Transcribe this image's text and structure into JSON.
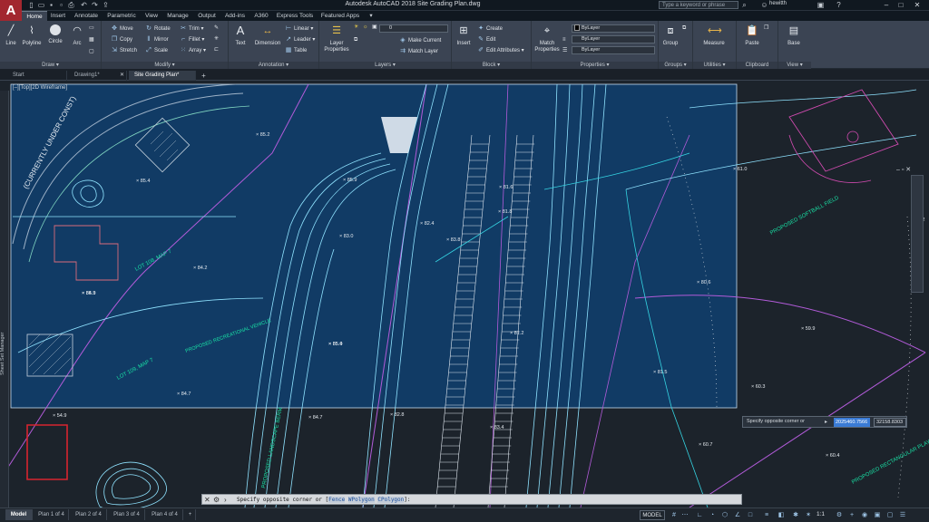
{
  "app": {
    "logo": "A",
    "title": "Autodesk AutoCAD 2018   Site Grading Plan.dwg"
  },
  "qat": [
    "new-file-icon",
    "open-folder-icon",
    "save-icon",
    "save-as-icon",
    "plot-icon",
    "undo-icon",
    "redo-icon",
    "share-icon"
  ],
  "search": {
    "placeholder": "Type a keyword or phrase"
  },
  "user": {
    "name": "hewitth"
  },
  "ribbon_tabs": [
    "Home",
    "Insert",
    "Annotate",
    "Parametric",
    "View",
    "Manage",
    "Output",
    "Add-ins",
    "A360",
    "Express Tools",
    "Featured Apps"
  ],
  "draw": {
    "title": "Draw ▾",
    "line": "Line",
    "polyline": "Polyline",
    "circle": "Circle",
    "arc": "Arc"
  },
  "modify": {
    "title": "Modify ▾",
    "move": "Move",
    "rotate": "Rotate",
    "trim": "Trim ▾",
    "copy": "Copy",
    "mirror": "Mirror",
    "fillet": "Fillet ▾",
    "stretch": "Stretch",
    "scale": "Scale",
    "array": "Array ▾"
  },
  "annotation": {
    "title": "Annotation ▾",
    "text": "Text",
    "dimension": "Dimension",
    "linear": "Linear ▾",
    "leader": "Leader ▾",
    "table": "Table"
  },
  "layers": {
    "title": "Layers ▾",
    "layer_properties": "Layer Properties",
    "current_layer": "0",
    "make_current": "Make Current",
    "match_layer": "Match Layer"
  },
  "block": {
    "title": "Block ▾",
    "insert": "Insert",
    "create": "Create",
    "edit": "Edit",
    "edit_attributes": "Edit Attributes ▾"
  },
  "properties": {
    "title": "Properties ▾",
    "match": "Match Properties",
    "color": "ByLayer",
    "linetype": "ByLayer",
    "lineweight": "ByLayer"
  },
  "groups": {
    "title": "Groups ▾",
    "group": "Group"
  },
  "utilities": {
    "title": "Utilities ▾",
    "measure": "Measure"
  },
  "clipboard": {
    "title": "Clipboard",
    "paste": "Paste"
  },
  "view": {
    "title": "View ▾",
    "base": "Base"
  },
  "file_tabs": [
    "Start",
    "Drawing1*",
    "Site Grading Plan*"
  ],
  "viewport_label": "[–][Top][2D Wireframe]",
  "palette_label": "Sheet Set Manager",
  "plan_labels": [
    {
      "text": "(CURRENTLY UNDER CONST)",
      "color": "#e8eef4"
    },
    {
      "text": "LOT 108, MAP 7",
      "color": "#19e0a5"
    },
    {
      "text": "LOT 109, MAP 7",
      "color": "#19e0a5"
    },
    {
      "text": "PROPOSED LANDSCAPE BERM",
      "color": "#19e0a5"
    },
    {
      "text": "PROPOSED RECREATIONAL VEHICLE",
      "color": "#19e0a5"
    },
    {
      "text": "PROPOSED SOFTBALL FIELD",
      "color": "#19e0a5"
    },
    {
      "text": "PROPOSED RECTANGULAR PLAYING FIELD",
      "color": "#19e0a5"
    }
  ],
  "spot_elevations": [
    "85.2",
    "85.4",
    "85.9",
    "84.3",
    "83.0",
    "82.4",
    "83.8",
    "81.6",
    "81.8",
    "84.2",
    "85.0",
    "81.2",
    "85.4",
    "84.7",
    "85.9",
    "84.7",
    "82.8",
    "83.4",
    "81.5",
    "80.6",
    "59.9",
    "60.3",
    "60.7",
    "60.4",
    "59.2",
    "61.0",
    "54.9"
  ],
  "selection": {
    "prompt": "Specify opposite corner or",
    "x": "2025460.7566",
    "y": "32158.8303"
  },
  "command": {
    "prompt": "Specify opposite corner or [",
    "opt1": "Fence",
    "opt2": "WPolygon",
    "opt3": "CPolygon",
    "close": "]:"
  },
  "layout_tabs": [
    "Model",
    "Plan 1 of 4",
    "Plan 2 of 4",
    "Plan 3 of 4",
    "Plan 4 of 4"
  ],
  "status": {
    "mode": "MODEL",
    "scale": "1:1"
  },
  "colors": {
    "background": "#1c232b",
    "selection_window": "#0f4070",
    "contour": "#8fe3ff",
    "road": "#b25bd9",
    "label": "#19e0a5"
  }
}
